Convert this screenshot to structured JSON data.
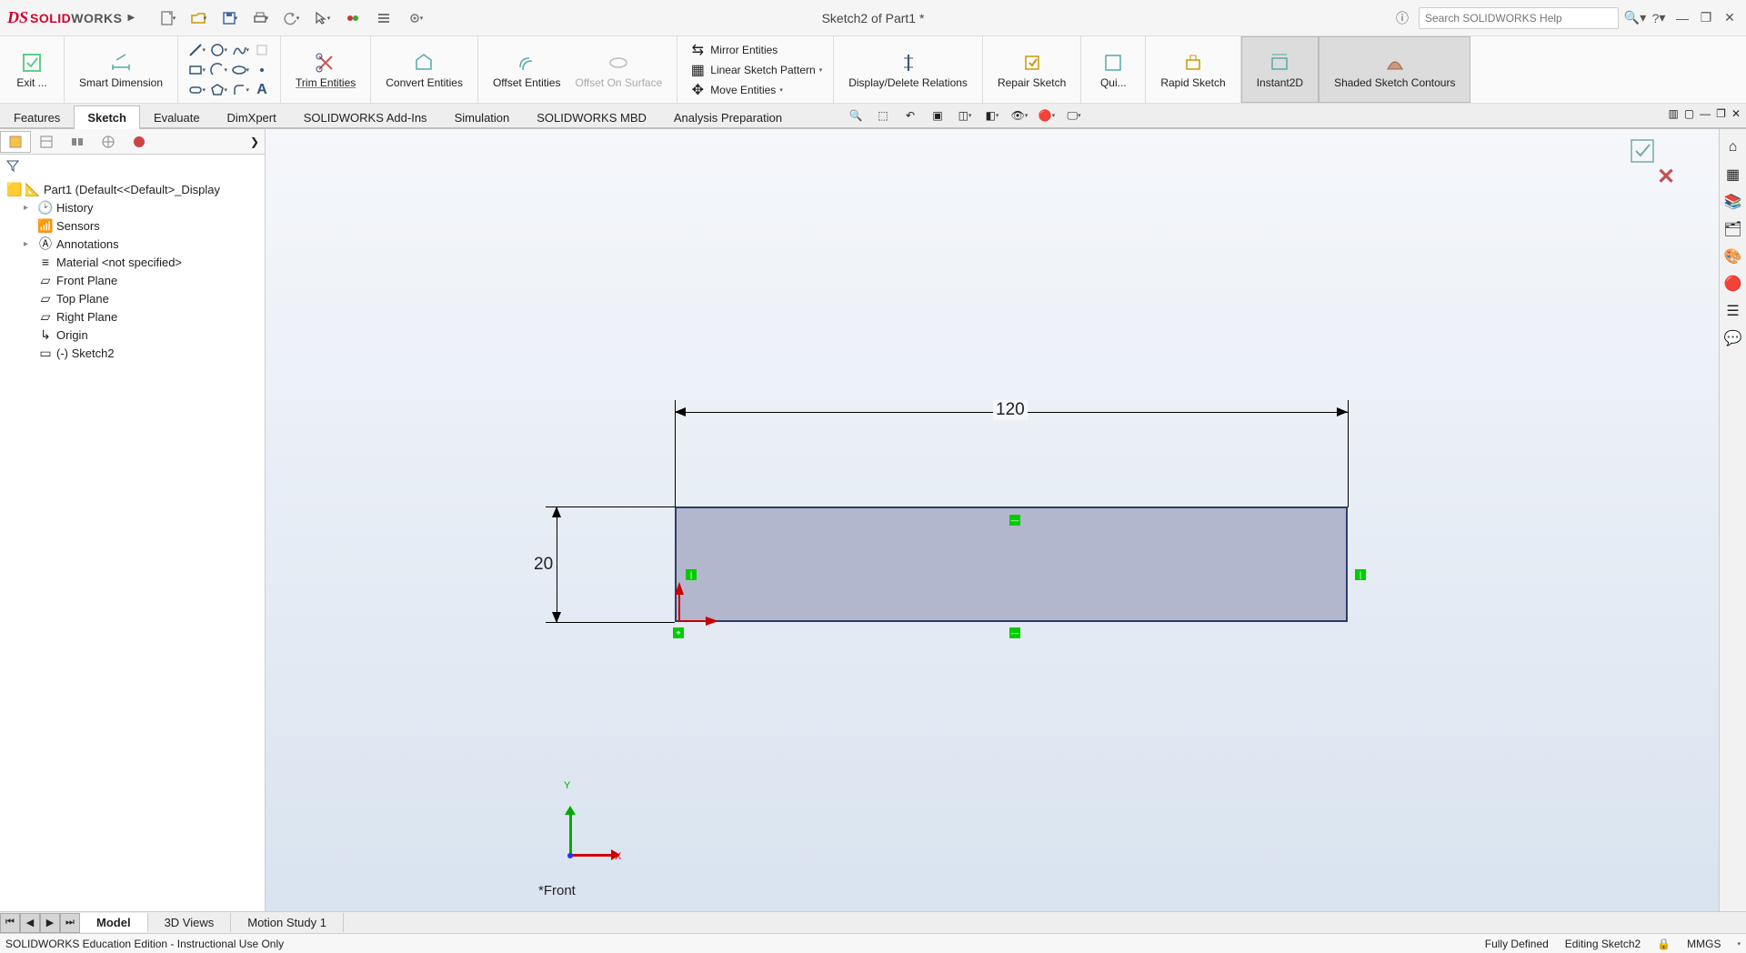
{
  "logo": {
    "ds": "DS",
    "solid": "SOLID",
    "works": "WORKS"
  },
  "doc_title": "Sketch2 of Part1 *",
  "search_placeholder": "Search SOLIDWORKS Help",
  "ribbon": {
    "exit": "Exit ...",
    "smart_dim": "Smart Dimension",
    "trim": "Trim Entities",
    "convert": "Convert Entities",
    "offset": "Offset Entities",
    "offset_surf": "Offset On Surface",
    "mirror": "Mirror Entities",
    "pattern": "Linear Sketch Pattern",
    "move": "Move Entities",
    "relations": "Display/Delete Relations",
    "repair": "Repair Sketch",
    "quick": "Qui...",
    "rapid": "Rapid Sketch",
    "instant": "Instant2D",
    "shaded": "Shaded Sketch Contours"
  },
  "tabs": [
    "Features",
    "Sketch",
    "Evaluate",
    "DimXpert",
    "SOLIDWORKS Add-Ins",
    "Simulation",
    "SOLIDWORKS MBD",
    "Analysis Preparation"
  ],
  "active_tab": "Sketch",
  "tree": {
    "root": "Part1  (Default<<Default>_Display",
    "history": "History",
    "sensors": "Sensors",
    "annotations": "Annotations",
    "material": "Material <not specified>",
    "front": "Front Plane",
    "top": "Top Plane",
    "right": "Right Plane",
    "origin": "Origin",
    "sketch": "(-) Sketch2"
  },
  "dims": {
    "width": "120",
    "height": "20"
  },
  "triad": {
    "x": "X",
    "y": "Y",
    "z": ""
  },
  "view_label": "*Front",
  "bottom_tabs": [
    "Model",
    "3D Views",
    "Motion Study 1"
  ],
  "status": {
    "edition": "SOLIDWORKS Education Edition - Instructional Use Only",
    "defined": "Fully Defined",
    "editing": "Editing Sketch2",
    "units": "MMGS"
  }
}
